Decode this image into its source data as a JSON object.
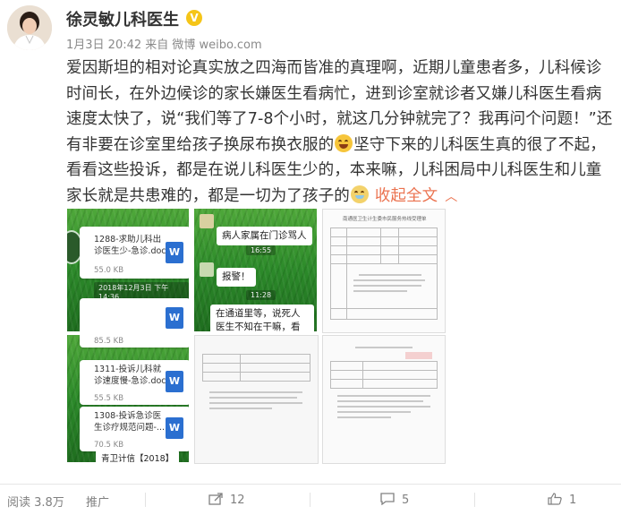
{
  "post": {
    "author_name": "徐灵敏儿科医生",
    "verified_badge_icon": "verified-v-icon",
    "meta": "1月3日 20:42 来自 微博 weibo.com",
    "lines": [
      "爱因斯坦的相对论真实放之四海而皆准的真理啊，近期儿童患者多，儿科候诊",
      "时间长，在外边候诊的家长嫌医生看病忙，进到诊室就诊者又嫌儿科医生看病",
      "速度太快了，说“我们等了7-8个小时，就这几分钟就完了？我再问个问题！”还",
      "有非要在诊室里给孩子换尿布换衣服的",
      "坚守下来的儿科医生真的很了不起，",
      "看看这些投诉，都是在说儿科医生少的，本来嘛，儿科困局中儿科医生和儿童",
      "家长就是共患难的，都是一切为了孩子的"
    ],
    "collapse_label": "收起全文",
    "collapse_icon": "chevron-up-icon"
  },
  "images": {
    "img1": {
      "doc_title": "1288-求助儿科出诊医生少-急诊.doc",
      "doc_size": "55.0 KB",
      "timestamp": "2018年12月3日 下午14:36",
      "doc_icon": "W"
    },
    "img2": {
      "bubble1": "病人家属在门诊骂人",
      "ts1": "16:55",
      "bubble2": "报警！",
      "ts2": "11:28",
      "bubble3": "在通道里等，说死人医生不知在干嘛，看来儒超慢"
    },
    "img3": {
      "header": "南通医卫生计生委市民服务热线受理单"
    },
    "img4": {
      "size_top": "85.5 KB",
      "doc1_title": "1311-投诉儿科就诊速度慢-急诊.doc",
      "doc1_size": "55.5 KB",
      "doc2_title": "1308-投诉急诊医生诊疗规范问题-...",
      "doc2_size": "70.5 KB",
      "footer": "青卫计信【2018】",
      "doc_icon": "W"
    }
  },
  "actions": {
    "read": "阅读 3.8万",
    "promote": "推广",
    "repost_count": "12",
    "comment_count": "5",
    "like_count": "1"
  },
  "colors": {
    "accent_link": "#eb7350",
    "verified_badge": "#f5c518",
    "text": "#333333",
    "meta_gray": "#8a8a8a"
  }
}
